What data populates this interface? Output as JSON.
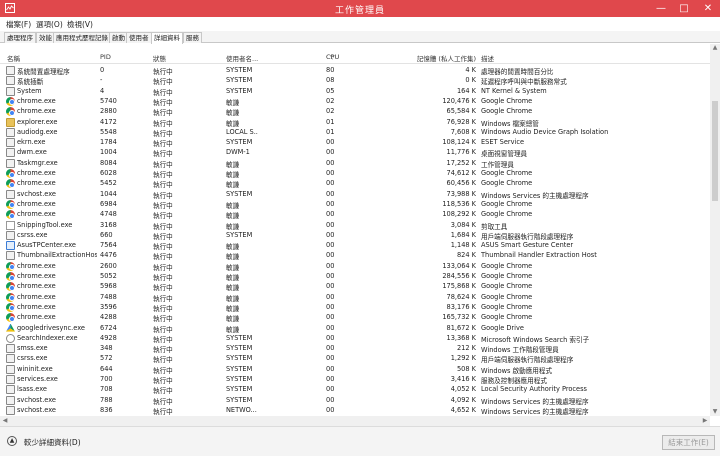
{
  "window": {
    "title": "工作管理員",
    "controls": {
      "minimize": "—",
      "maximize": "□",
      "close": "✕"
    },
    "accent_color": "#e0484c"
  },
  "menu": [
    "檔案(F)",
    "選項(O)",
    "檢視(V)"
  ],
  "tabs": [
    {
      "label": "處理程序",
      "active": false
    },
    {
      "label": "效能",
      "active": false
    },
    {
      "label": "應用程式歷程記錄",
      "active": false
    },
    {
      "label": "啟動",
      "active": false
    },
    {
      "label": "使用者",
      "active": false
    },
    {
      "label": "詳細資料",
      "active": true
    },
    {
      "label": "服務",
      "active": false
    }
  ],
  "columns": {
    "name": "名稱",
    "pid": "PID",
    "status": "狀態",
    "user": "使用者名...",
    "cpu": "CPU",
    "memory": "記憶體 (私人工作集)",
    "description": "描述"
  },
  "rows": [
    {
      "icon": "gear-icon",
      "name": "系統閒置處理程序",
      "pid": "0",
      "status": "執行中",
      "user": "SYSTEM",
      "cpu": "80",
      "mem": "4 K",
      "desc": "處理器的閒置時間百分比"
    },
    {
      "icon": "gear-icon",
      "name": "系統插斷",
      "pid": "-",
      "status": "執行中",
      "user": "SYSTEM",
      "cpu": "08",
      "mem": "0 K",
      "desc": "延遲程序呼叫與中斷服務常式"
    },
    {
      "icon": "gear-icon",
      "name": "System",
      "pid": "4",
      "status": "執行中",
      "user": "SYSTEM",
      "cpu": "05",
      "mem": "164 K",
      "desc": "NT Kernel & System"
    },
    {
      "icon": "chrome-icon",
      "name": "chrome.exe",
      "pid": "5740",
      "status": "執行中",
      "user": "敏謙",
      "cpu": "02",
      "mem": "120,476 K",
      "desc": "Google Chrome"
    },
    {
      "icon": "chrome-icon",
      "name": "chrome.exe",
      "pid": "2880",
      "status": "執行中",
      "user": "敏謙",
      "cpu": "02",
      "mem": "65,584 K",
      "desc": "Google Chrome"
    },
    {
      "icon": "folder-icon",
      "name": "explorer.exe",
      "pid": "4172",
      "status": "執行中",
      "user": "敏謙",
      "cpu": "01",
      "mem": "76,928 K",
      "desc": "Windows 檔案總管"
    },
    {
      "icon": "gear-icon",
      "name": "audiodg.exe",
      "pid": "5548",
      "status": "執行中",
      "user": "LOCAL S...",
      "cpu": "01",
      "mem": "7,608 K",
      "desc": "Windows Audio Device Graph Isolation"
    },
    {
      "icon": "gear-icon",
      "name": "ekrn.exe",
      "pid": "1784",
      "status": "執行中",
      "user": "SYSTEM",
      "cpu": "00",
      "mem": "108,124 K",
      "desc": "ESET Service"
    },
    {
      "icon": "gear-icon",
      "name": "dwm.exe",
      "pid": "1004",
      "status": "執行中",
      "user": "DWM-1",
      "cpu": "00",
      "mem": "11,776 K",
      "desc": "桌面視窗管理員"
    },
    {
      "icon": "gear-icon",
      "name": "Taskmgr.exe",
      "pid": "8084",
      "status": "執行中",
      "user": "敏謙",
      "cpu": "00",
      "mem": "17,252 K",
      "desc": "工作管理員"
    },
    {
      "icon": "chrome-icon",
      "name": "chrome.exe",
      "pid": "6028",
      "status": "執行中",
      "user": "敏謙",
      "cpu": "00",
      "mem": "74,612 K",
      "desc": "Google Chrome"
    },
    {
      "icon": "chrome-icon",
      "name": "chrome.exe",
      "pid": "5452",
      "status": "執行中",
      "user": "敏謙",
      "cpu": "00",
      "mem": "60,456 K",
      "desc": "Google Chrome"
    },
    {
      "icon": "gear-icon",
      "name": "svchost.exe",
      "pid": "1044",
      "status": "執行中",
      "user": "SYSTEM",
      "cpu": "00",
      "mem": "73,988 K",
      "desc": "Windows Services 的主機處理程序"
    },
    {
      "icon": "chrome-icon",
      "name": "chrome.exe",
      "pid": "6984",
      "status": "執行中",
      "user": "敏謙",
      "cpu": "00",
      "mem": "118,536 K",
      "desc": "Google Chrome"
    },
    {
      "icon": "chrome-icon",
      "name": "chrome.exe",
      "pid": "4748",
      "status": "執行中",
      "user": "敏謙",
      "cpu": "00",
      "mem": "108,292 K",
      "desc": "Google Chrome"
    },
    {
      "icon": "scissors-icon",
      "name": "SnippingTool.exe",
      "pid": "3168",
      "status": "執行中",
      "user": "敏謙",
      "cpu": "00",
      "mem": "3,084 K",
      "desc": "剪取工具"
    },
    {
      "icon": "gear-icon",
      "name": "csrss.exe",
      "pid": "660",
      "status": "執行中",
      "user": "SYSTEM",
      "cpu": "00",
      "mem": "1,684 K",
      "desc": "用戶端伺服器執行階段處理程序"
    },
    {
      "icon": "asus-icon",
      "name": "AsusTPCenter.exe",
      "pid": "7564",
      "status": "執行中",
      "user": "敏謙",
      "cpu": "00",
      "mem": "1,148 K",
      "desc": "ASUS Smart Gesture Center"
    },
    {
      "icon": "gear-icon",
      "name": "ThumbnailExtractionHos...",
      "pid": "4476",
      "status": "執行中",
      "user": "敏謙",
      "cpu": "00",
      "mem": "824 K",
      "desc": "Thumbnail Handler Extraction Host"
    },
    {
      "icon": "chrome-icon",
      "name": "chrome.exe",
      "pid": "2600",
      "status": "執行中",
      "user": "敏謙",
      "cpu": "00",
      "mem": "133,064 K",
      "desc": "Google Chrome"
    },
    {
      "icon": "chrome-icon",
      "name": "chrome.exe",
      "pid": "5052",
      "status": "執行中",
      "user": "敏謙",
      "cpu": "00",
      "mem": "284,556 K",
      "desc": "Google Chrome"
    },
    {
      "icon": "chrome-icon",
      "name": "chrome.exe",
      "pid": "5968",
      "status": "執行中",
      "user": "敏謙",
      "cpu": "00",
      "mem": "175,868 K",
      "desc": "Google Chrome"
    },
    {
      "icon": "chrome-icon",
      "name": "chrome.exe",
      "pid": "7488",
      "status": "執行中",
      "user": "敏謙",
      "cpu": "00",
      "mem": "78,624 K",
      "desc": "Google Chrome"
    },
    {
      "icon": "chrome-icon",
      "name": "chrome.exe",
      "pid": "3596",
      "status": "執行中",
      "user": "敏謙",
      "cpu": "00",
      "mem": "83,176 K",
      "desc": "Google Chrome"
    },
    {
      "icon": "chrome-icon",
      "name": "chrome.exe",
      "pid": "4288",
      "status": "執行中",
      "user": "敏謙",
      "cpu": "00",
      "mem": "165,732 K",
      "desc": "Google Chrome"
    },
    {
      "icon": "google-drive-icon",
      "name": "googledrivesync.exe",
      "pid": "6724",
      "status": "執行中",
      "user": "敏謙",
      "cpu": "00",
      "mem": "81,672 K",
      "desc": "Google Drive"
    },
    {
      "icon": "search-icon",
      "name": "SearchIndexer.exe",
      "pid": "4928",
      "status": "執行中",
      "user": "SYSTEM",
      "cpu": "00",
      "mem": "13,368 K",
      "desc": "Microsoft Windows Search 索引子"
    },
    {
      "icon": "gear-icon",
      "name": "smss.exe",
      "pid": "348",
      "status": "執行中",
      "user": "SYSTEM",
      "cpu": "00",
      "mem": "212 K",
      "desc": "Windows 工作階段管理員"
    },
    {
      "icon": "gear-icon",
      "name": "csrss.exe",
      "pid": "572",
      "status": "執行中",
      "user": "SYSTEM",
      "cpu": "00",
      "mem": "1,292 K",
      "desc": "用戶端伺服器執行階段處理程序"
    },
    {
      "icon": "gear-icon",
      "name": "wininit.exe",
      "pid": "644",
      "status": "執行中",
      "user": "SYSTEM",
      "cpu": "00",
      "mem": "508 K",
      "desc": "Windows 啟動應用程式"
    },
    {
      "icon": "gear-icon",
      "name": "services.exe",
      "pid": "700",
      "status": "執行中",
      "user": "SYSTEM",
      "cpu": "00",
      "mem": "3,416 K",
      "desc": "服務及控制器應用程式"
    },
    {
      "icon": "gear-icon",
      "name": "lsass.exe",
      "pid": "708",
      "status": "執行中",
      "user": "SYSTEM",
      "cpu": "00",
      "mem": "4,052 K",
      "desc": "Local Security Authority Process"
    },
    {
      "icon": "gear-icon",
      "name": "svchost.exe",
      "pid": "788",
      "status": "執行中",
      "user": "SYSTEM",
      "cpu": "00",
      "mem": "4,092 K",
      "desc": "Windows Services 的主機處理程序"
    },
    {
      "icon": "gear-icon",
      "name": "svchost.exe",
      "pid": "836",
      "status": "執行中",
      "user": "NETWO...",
      "cpu": "00",
      "mem": "4,652 K",
      "desc": "Windows Services 的主機處理程序"
    }
  ],
  "footer": {
    "fewer_details": "較少詳細資料(D)",
    "end_task": "結束工作(E)"
  }
}
